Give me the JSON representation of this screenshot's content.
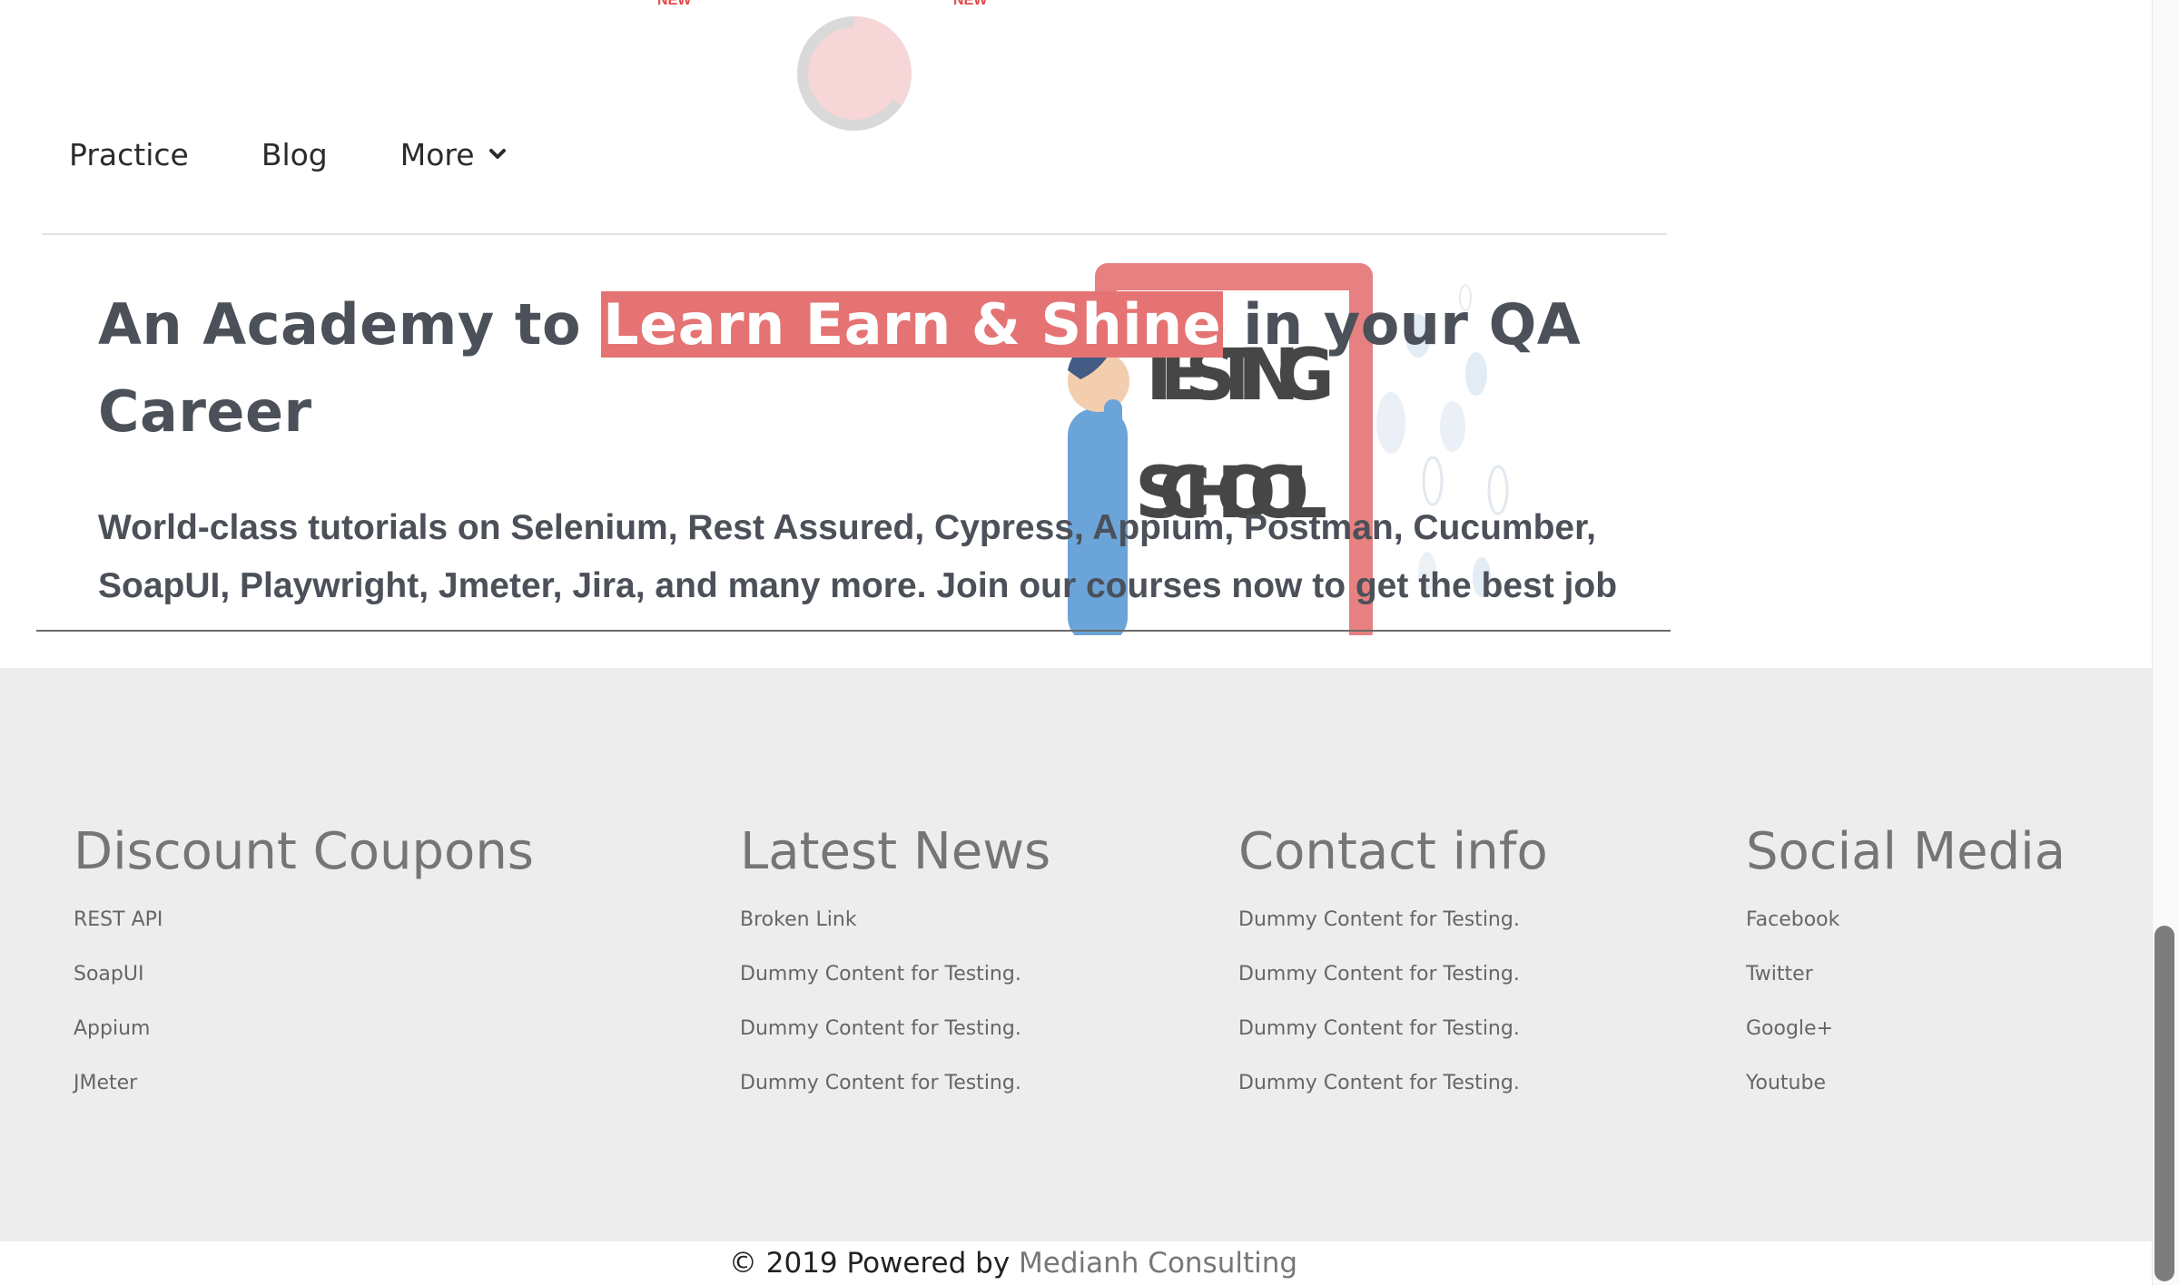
{
  "top_menu": {
    "badge_1": "NEW",
    "badge_2": "NEW"
  },
  "nav": {
    "items": [
      {
        "label": "Practice"
      },
      {
        "label": "Blog"
      },
      {
        "label": "More"
      }
    ]
  },
  "hero": {
    "title_pre": "An Academy to ",
    "title_highlight": "Learn Earn & Shine",
    "title_post": "  in your QA Career",
    "subtitle": "World-class tutorials on Selenium, Rest Assured, Cypress, Appium, Postman, Cucumber, SoapUI, Playwright, Jmeter, Jira, and many more. Join our courses now to get the best job",
    "art_text_1": "TESTING",
    "art_text_2": "SCHOOL"
  },
  "footer": {
    "columns": [
      {
        "heading": "Discount Coupons",
        "links": [
          "REST API",
          "SoapUI",
          "Appium",
          "JMeter"
        ]
      },
      {
        "heading": "Latest News",
        "links": [
          "Broken Link",
          "Dummy Content for Testing.",
          "Dummy Content for Testing.",
          "Dummy Content for Testing."
        ]
      },
      {
        "heading": "Contact info",
        "links": [
          "Dummy Content for Testing.",
          "Dummy Content for Testing.",
          "Dummy Content for Testing.",
          "Dummy Content for Testing."
        ]
      },
      {
        "heading": "Social Media",
        "links": [
          "Facebook",
          "Twitter",
          "Google+",
          "Youtube"
        ]
      }
    ]
  },
  "copyright": {
    "prefix": "© 2019 Powered by ",
    "brand": "Medianh Consulting"
  },
  "colors": {
    "highlight": "#e57373",
    "footer_bg": "#ededed",
    "text_dark": "#4b5059",
    "badge_red": "#e44a4a"
  }
}
